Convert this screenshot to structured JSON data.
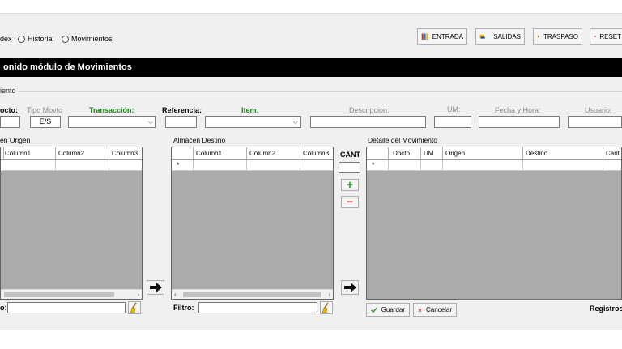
{
  "view_options": [
    {
      "label": "dex"
    },
    {
      "label": "Historial"
    },
    {
      "label": "Movimientos"
    }
  ],
  "toolbar": {
    "entrada": "ENTRADA",
    "salidas": "SALIDAS",
    "traspaso": "TRASPASO",
    "reset": "RESET"
  },
  "title": "onido módulo de Movimientos",
  "group_label": "iento",
  "form": {
    "docto_label": "octo:",
    "tipo_label": "Tipo Movto",
    "tipo_value": "E/S",
    "transaccion_label": "Transacción:",
    "referencia_label": "Referencia:",
    "item_label": "Item:",
    "descripcion_label": "Descripcion:",
    "um_label": "UM:",
    "fecha_label": "Fecha y Hora:",
    "usuario_label": "Usuario:"
  },
  "origen": {
    "title": "en Origen",
    "columns": [
      "Column1",
      "Column2",
      "Column3"
    ],
    "filter_label": "o:"
  },
  "destino": {
    "title": "Almacen Destino",
    "columns": [
      "Column1",
      "Column2",
      "Column3"
    ],
    "new_row_marker": "*",
    "filter_label": "Filtro:"
  },
  "cant": {
    "label": "CANT",
    "plus": "+",
    "minus": "−"
  },
  "detalle": {
    "title": "Detalle del Movimiento",
    "columns": [
      "Docto",
      "UM",
      "Origen",
      "Destino",
      "Cant."
    ],
    "new_row_marker": "*"
  },
  "actions": {
    "guardar": "Guardar",
    "cancelar": "Cancelar",
    "registros": "Registros"
  },
  "colors": {
    "accent_green": "#1a7f1a",
    "reset_red": "#d22020",
    "grid_bg": "#ababab"
  }
}
